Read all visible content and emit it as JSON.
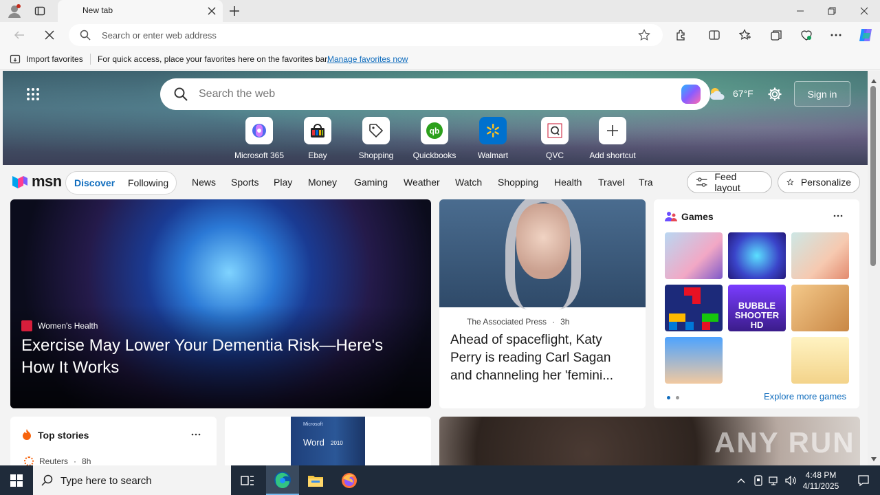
{
  "browser": {
    "tab_title": "New tab",
    "address_placeholder": "Search or enter web address"
  },
  "favorites_bar": {
    "import_label": "Import favorites",
    "message": "For quick access, place your favorites here on the favorites bar.",
    "manage_link": "Manage favorites now"
  },
  "hero": {
    "search_placeholder": "Search the web",
    "temperature": "67°F",
    "sign_in": "Sign in",
    "shortcuts": [
      {
        "label": "Microsoft 365",
        "icon": "m365-icon"
      },
      {
        "label": "Ebay",
        "icon": "ebay-icon"
      },
      {
        "label": "Shopping",
        "icon": "shopping-tag-icon"
      },
      {
        "label": "Quickbooks",
        "icon": "quickbooks-icon"
      },
      {
        "label": "Walmart",
        "icon": "walmart-icon"
      },
      {
        "label": "QVC",
        "icon": "qvc-icon"
      },
      {
        "label": "Add shortcut",
        "icon": "plus-icon"
      }
    ]
  },
  "msn_nav": {
    "logo": "msn",
    "segments": [
      "Discover",
      "Following"
    ],
    "links": [
      "News",
      "Sports",
      "Play",
      "Money",
      "Gaming",
      "Weather",
      "Watch",
      "Shopping",
      "Health",
      "Travel",
      "Tra"
    ],
    "feed_layout": "Feed layout",
    "personalize": "Personalize"
  },
  "cards": {
    "main": {
      "source": "Women's Health",
      "title": "Exercise May Lower Your Dementia Risk—Here's How It Works"
    },
    "news": {
      "source": "The Associated Press",
      "age": "3h",
      "title": "Ahead of spaceflight, Katy Perry is reading Carl Sagan and channeling her 'femini..."
    },
    "games": {
      "title": "Games",
      "explore": "Explore more games",
      "tile_text": "BUBBLE SHOOTER HD"
    },
    "top_stories": {
      "title": "Top stories",
      "source": "Reuters",
      "age": "8h"
    },
    "word": {
      "product": "Word",
      "brand": "Microsoft",
      "version": "2010"
    }
  },
  "watermark": "ANY RUN",
  "taskbar": {
    "search_placeholder": "Type here to search",
    "time": "4:48 PM",
    "date": "4/11/2025"
  },
  "colors": {
    "accent": "#0f6cbd",
    "taskbar": "#1f2b3a"
  }
}
